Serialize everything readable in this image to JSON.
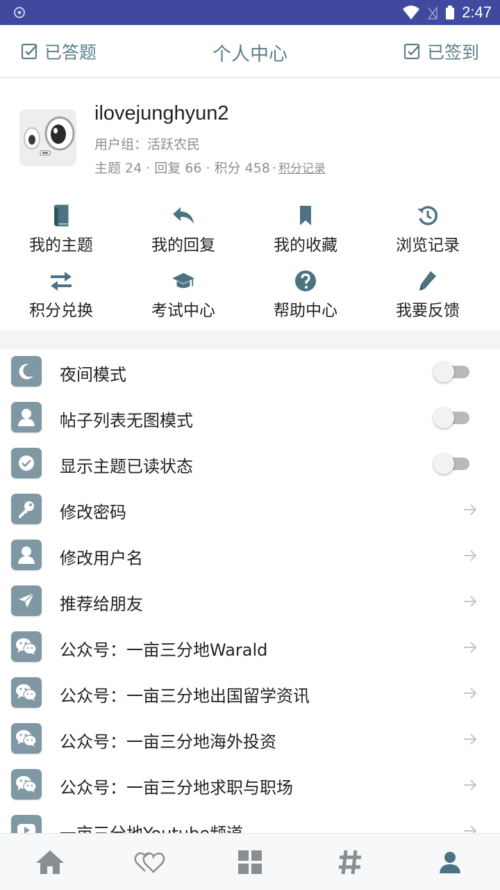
{
  "status_bar": {
    "time": "2:47"
  },
  "header": {
    "left_button": "已答题",
    "title": "个人中心",
    "right_button": "已签到"
  },
  "profile": {
    "username": "ilovejunghyun2",
    "group": "用户组：活跃农民",
    "stats": {
      "topics": "主题 24",
      "replies": "回复 66",
      "points": "积分 458",
      "points_log": "积分记录"
    }
  },
  "grid": [
    {
      "label": "我的主题",
      "icon": "book-icon"
    },
    {
      "label": "我的回复",
      "icon": "reply-icon"
    },
    {
      "label": "我的收藏",
      "icon": "bookmark-icon"
    },
    {
      "label": "浏览记录",
      "icon": "history-icon"
    },
    {
      "label": "积分兑换",
      "icon": "exchange-icon"
    },
    {
      "label": "考试中心",
      "icon": "graduation-cap-icon"
    },
    {
      "label": "帮助中心",
      "icon": "help-icon"
    },
    {
      "label": "我要反馈",
      "icon": "pencil-icon"
    }
  ],
  "settings": [
    {
      "label": "夜间模式",
      "icon": "moon-icon",
      "control": "toggle",
      "on": false
    },
    {
      "label": "帖子列表无图模式",
      "icon": "user-icon",
      "control": "toggle",
      "on": false
    },
    {
      "label": "显示主题已读状态",
      "icon": "check-circle-icon",
      "control": "toggle",
      "on": false
    },
    {
      "label": "修改密码",
      "icon": "key-icon",
      "control": "arrow"
    },
    {
      "label": "修改用户名",
      "icon": "user-icon",
      "control": "arrow"
    },
    {
      "label": "推荐给朋友",
      "icon": "send-icon",
      "control": "arrow"
    },
    {
      "label": "公众号：一亩三分地Warald",
      "icon": "wechat-icon",
      "control": "arrow"
    },
    {
      "label": "公众号：一亩三分地出国留学资讯",
      "icon": "wechat-icon",
      "control": "arrow"
    },
    {
      "label": "公众号：一亩三分地海外投资",
      "icon": "wechat-icon",
      "control": "arrow"
    },
    {
      "label": "公众号：一亩三分地求职与职场",
      "icon": "wechat-icon",
      "control": "arrow"
    },
    {
      "label": "一亩三分地Youtube频道",
      "icon": "youtube-icon",
      "control": "arrow"
    }
  ],
  "bottom_nav": [
    {
      "name": "home",
      "icon": "home-icon",
      "active": false
    },
    {
      "name": "favorites",
      "icon": "hearts-icon",
      "active": false
    },
    {
      "name": "forums",
      "icon": "grid-icon",
      "active": false
    },
    {
      "name": "topics",
      "icon": "hashtag-icon",
      "active": false
    },
    {
      "name": "profile",
      "icon": "person-icon",
      "active": true
    }
  ],
  "colors": {
    "accent": "#5c7f8c",
    "status_bar": "#3f4a9e",
    "icon_tile": "#7f98a3",
    "nav_icon": "#8a8e91",
    "nav_active": "#4c7381"
  }
}
